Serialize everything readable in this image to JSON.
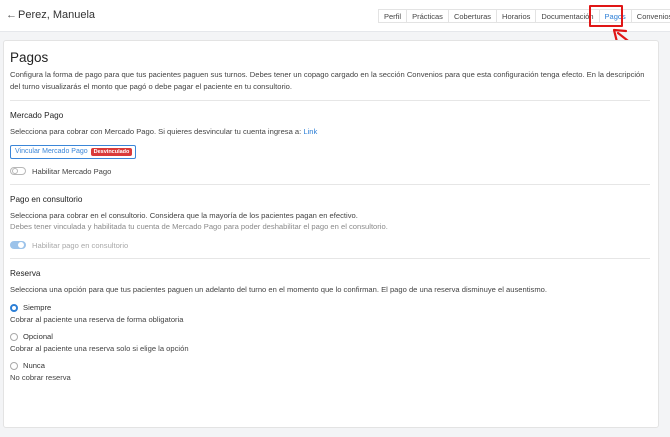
{
  "header": {
    "patient_name": "Perez, Manuela",
    "back_glyph": "←",
    "tabs": [
      {
        "label": "Perfil"
      },
      {
        "label": "Prácticas"
      },
      {
        "label": "Coberturas"
      },
      {
        "label": "Horarios"
      },
      {
        "label": "Documentación"
      },
      {
        "label": "Pagos"
      },
      {
        "label": "Convenios"
      }
    ],
    "active_tab": "Pagos"
  },
  "page": {
    "title": "Pagos",
    "description": "Configura la forma de pago para que tus pacientes paguen sus turnos. Debes tener un copago cargado en la sección Convenios para que esta configuración tenga efecto. En la descripción del turno visualizarás el monto que pagó o debe pagar el paciente en tu consultorio."
  },
  "mercado_pago": {
    "title": "Mercado Pago",
    "text": "Selecciona para cobrar con Mercado Pago. Si quieres desvincular tu cuenta ingresa a:",
    "link": "Link",
    "button_label": "Vincular Mercado Pago",
    "badge": "Desvinculado",
    "toggle_label": "Habilitar Mercado Pago",
    "toggle_on": false
  },
  "consultorio": {
    "title": "Pago en consultorio",
    "text": "Selecciona para cobrar en el consultorio. Considera que la mayoría de los pacientes pagan en efectivo.",
    "note": "Debes tener vinculada y habilitada tu cuenta de Mercado Pago para poder deshabilitar el pago en el consultorio.",
    "toggle_label": "Habilitar pago en consultorio",
    "toggle_on": true
  },
  "reserva": {
    "title": "Reserva",
    "text": "Selecciona una opción para que tus pacientes paguen un adelanto del turno en el momento que lo confirman. El pago de una reserva disminuye el ausentismo.",
    "options": [
      {
        "label": "Siempre",
        "desc": "Cobrar al paciente una reserva de forma obligatoria",
        "selected": true
      },
      {
        "label": "Opcional",
        "desc": "Cobrar al paciente una reserva solo si elige la opción",
        "selected": false
      },
      {
        "label": "Nunca",
        "desc": "No cobrar reserva",
        "selected": false
      }
    ]
  },
  "colors": {
    "accent": "#2d7fd6",
    "badge": "#d93a3a",
    "annotation": "#e01616"
  }
}
